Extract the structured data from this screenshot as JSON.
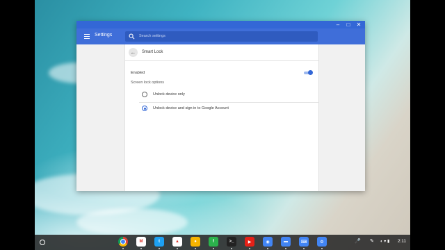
{
  "window": {
    "controls": {
      "minimize": "‒",
      "maximize": "□",
      "close": "✕"
    }
  },
  "app": {
    "title": "Settings",
    "search_placeholder": "Search settings"
  },
  "page": {
    "title": "Smart Lock",
    "enabled_label": "Enabled",
    "enabled": true,
    "section_label": "Screen lock options",
    "options": [
      {
        "label": "Unlock device only",
        "selected": false
      },
      {
        "label": "Unlock device and sign in to Google Account",
        "selected": true
      }
    ]
  },
  "shelf": {
    "apps": [
      {
        "name": "chrome-icon",
        "glyph": "",
        "bg": "#ffffff"
      },
      {
        "name": "gmail-icon",
        "glyph": "M",
        "bg": "#ffffff"
      },
      {
        "name": "twitter-icon",
        "glyph": "t",
        "bg": "#1da1f2"
      },
      {
        "name": "google-drive-icon",
        "glyph": "▲",
        "bg": "#ffffff"
      },
      {
        "name": "google-keep-icon",
        "glyph": "●",
        "bg": "#f6b400"
      },
      {
        "name": "feedly-icon",
        "glyph": "f",
        "bg": "#2bb24c"
      },
      {
        "name": "crosh-terminal-icon",
        "glyph": ">_",
        "bg": "#222222"
      },
      {
        "name": "youtube-icon",
        "glyph": "▶",
        "bg": "#e62117"
      },
      {
        "name": "camera-icon",
        "glyph": "◉",
        "bg": "#4285f4"
      },
      {
        "name": "files-icon",
        "glyph": "▬",
        "bg": "#4285f4"
      },
      {
        "name": "keyboard-icon",
        "glyph": "⌨",
        "bg": "#4285f4"
      },
      {
        "name": "settings-icon",
        "glyph": "⚙",
        "bg": "#4285f4"
      }
    ],
    "tray": {
      "mic_glyph": "🎤",
      "pen_glyph": "✎",
      "time": "2:11"
    }
  }
}
